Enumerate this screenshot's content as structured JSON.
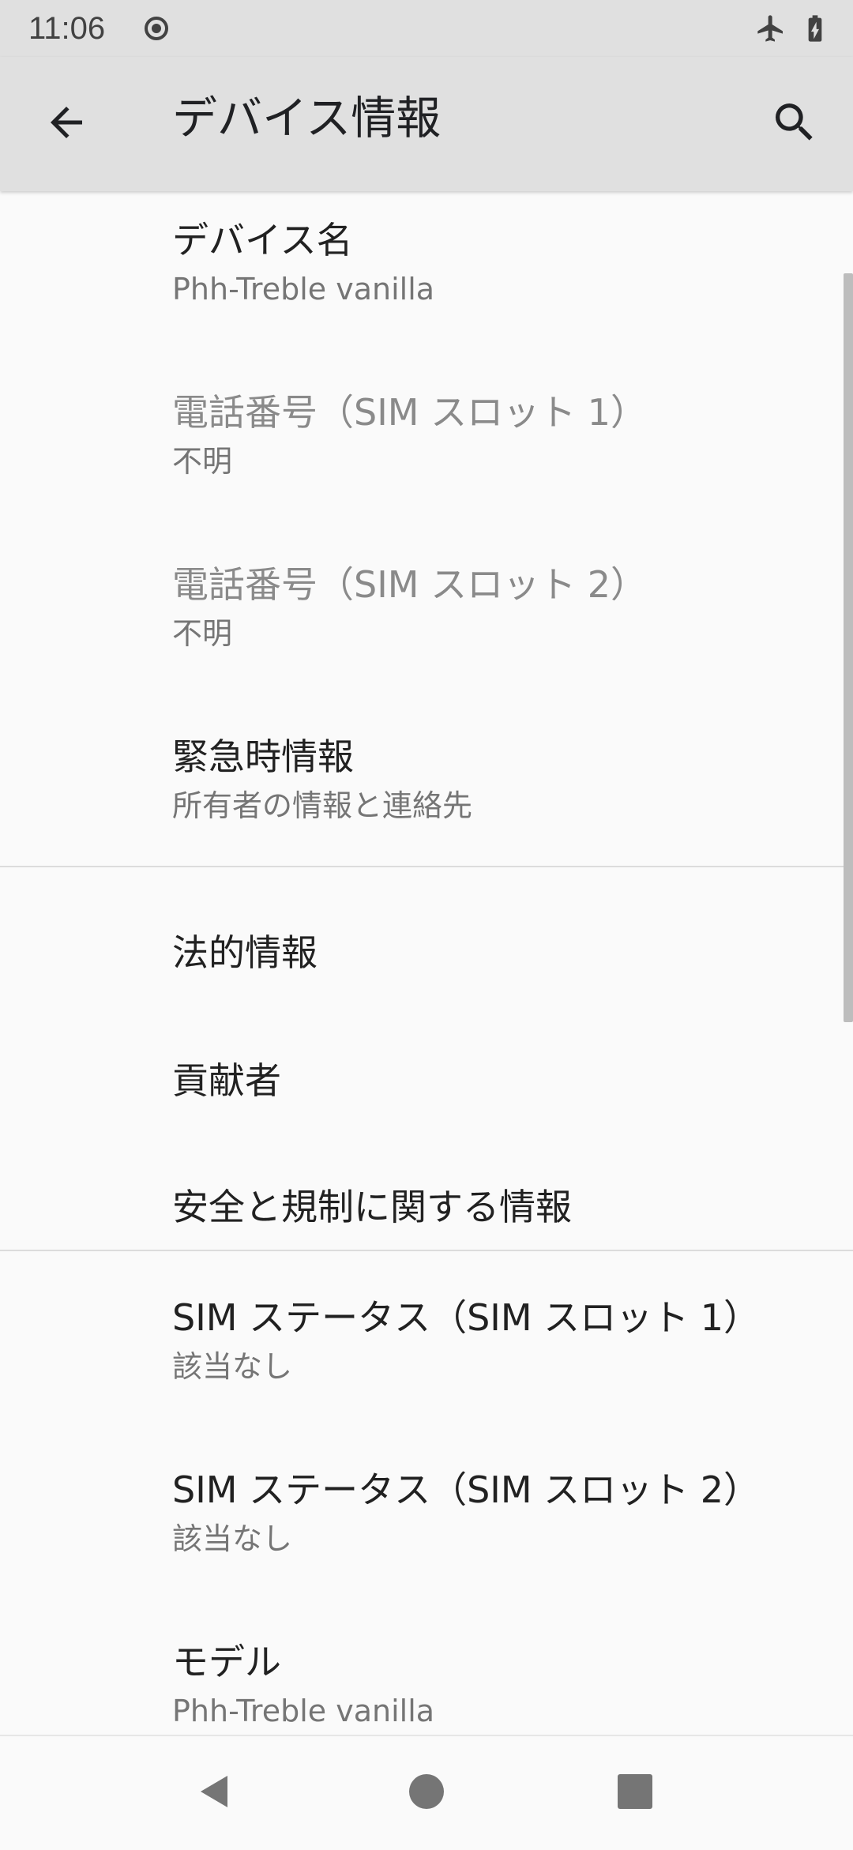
{
  "status_bar": {
    "time": "11:06",
    "icons": [
      "record-icon",
      "airplane-mode-icon",
      "battery-charging-icon"
    ]
  },
  "app_bar": {
    "title": "デバイス情報",
    "back_icon": "arrow-back-icon",
    "search_icon": "search-icon"
  },
  "items": [
    {
      "title": "デバイス名",
      "summary": "Phh-Treble vanilla",
      "enabled": true
    },
    {
      "title": "電話番号（SIM スロット 1）",
      "summary": "不明",
      "enabled": false
    },
    {
      "title": "電話番号（SIM スロット 2）",
      "summary": "不明",
      "enabled": false
    },
    {
      "title": "緊急時情報",
      "summary": "所有者の情報と連絡先",
      "enabled": true
    },
    {
      "title": "法的情報",
      "enabled": true
    },
    {
      "title": "貢献者",
      "enabled": true
    },
    {
      "title": "安全と規制に関する情報",
      "enabled": true
    },
    {
      "title": "SIM ステータス（SIM スロット 1）",
      "summary": "該当なし",
      "enabled": true
    },
    {
      "title": "SIM ステータス（SIM スロット 2）",
      "summary": "該当なし",
      "enabled": true
    },
    {
      "title": "モデル",
      "summary": "Phh-Treble vanilla",
      "enabled": true
    }
  ],
  "nav_bar": {
    "icons": [
      "nav-back-icon",
      "nav-home-icon",
      "nav-recents-icon"
    ]
  },
  "colors": {
    "app_bar_bg": "#e0e0e0",
    "background": "#fafafa",
    "title_text": "#212121",
    "summary_text": "#757575",
    "disabled_text": "#8a8a8a"
  }
}
